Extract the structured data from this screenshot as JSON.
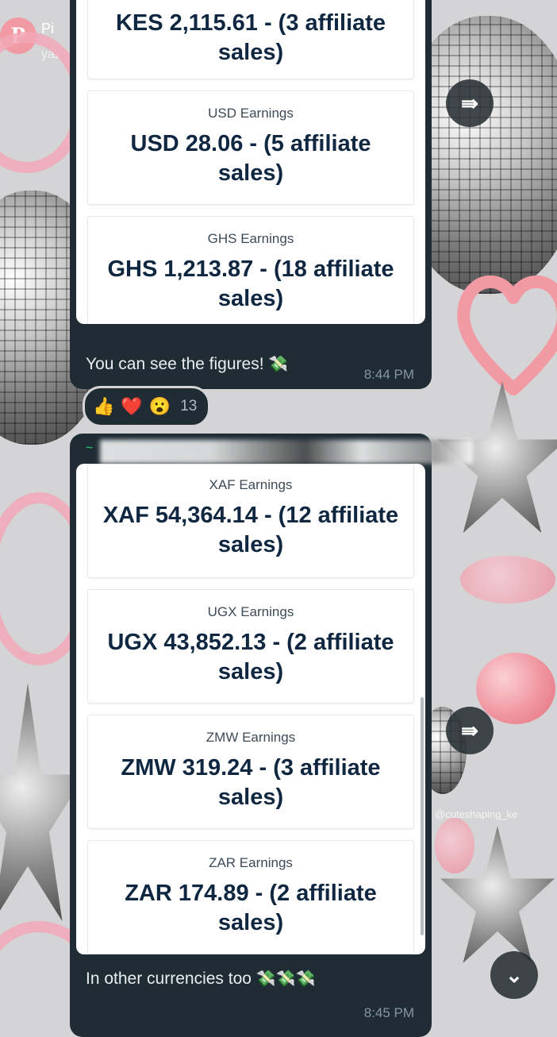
{
  "wallpaper": {
    "pin_logo": "P",
    "pin_text": "Pi",
    "pin_sub": "yaz",
    "watermark": "@cuteshaping_ke"
  },
  "messages": [
    {
      "cards": [
        {
          "title": "",
          "value": "KES 2,115.61 - (3 affiliate sales)"
        },
        {
          "title": "USD Earnings",
          "value": "USD 28.06 - (5 affiliate sales)"
        },
        {
          "title": "GHS Earnings",
          "value": "GHS 1,213.87 - (18 affiliate sales)"
        }
      ],
      "text": "You can see the figures!",
      "emoji": "💸",
      "time": "8:44 PM"
    },
    {
      "sender": "~",
      "cards": [
        {
          "title": "XAF Earnings",
          "value": "XAF 54,364.14 - (12 affiliate sales)"
        },
        {
          "title": "UGX Earnings",
          "value": "UGX 43,852.13 - (2 affiliate sales)"
        },
        {
          "title": "ZMW Earnings",
          "value": "ZMW 319.24 - (3 affiliate sales)"
        },
        {
          "title": "ZAR Earnings",
          "value": "ZAR 174.89 - (2 affiliate sales)"
        }
      ],
      "text": "In other currencies too",
      "emoji": "💸💸💸",
      "time": "8:45 PM"
    }
  ],
  "reactions": {
    "emojis": [
      "👍",
      "❤️",
      "😮"
    ],
    "count": "13"
  },
  "buttons": {
    "forward_icon": "⇛",
    "scroll_down_icon": "⌄"
  },
  "colors": {
    "bubble": "#1f2c34",
    "card_value": "#0f2740",
    "time": "#8696a0",
    "sender": "#25d366"
  }
}
